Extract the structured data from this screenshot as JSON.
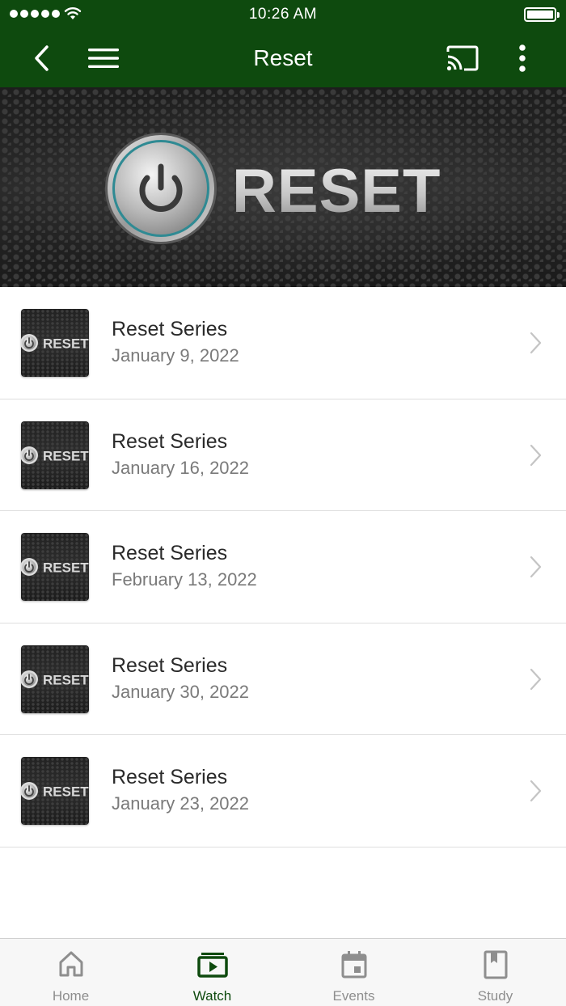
{
  "status_bar": {
    "time": "10:26 AM"
  },
  "nav": {
    "title": "Reset"
  },
  "banner": {
    "logo_text": "RESET"
  },
  "items": [
    {
      "title": "Reset Series",
      "date": "January 9, 2022",
      "thumb_text": "RESET"
    },
    {
      "title": "Reset Series",
      "date": "January 16, 2022",
      "thumb_text": "RESET"
    },
    {
      "title": "Reset Series",
      "date": "February 13, 2022",
      "thumb_text": "RESET"
    },
    {
      "title": "Reset Series",
      "date": "January 30, 2022",
      "thumb_text": "RESET"
    },
    {
      "title": "Reset Series",
      "date": "January 23, 2022",
      "thumb_text": "RESET"
    }
  ],
  "tabs": [
    {
      "label": "Home",
      "icon": "home-icon",
      "active": false
    },
    {
      "label": "Watch",
      "icon": "watch-icon",
      "active": true
    },
    {
      "label": "Events",
      "icon": "calendar-icon",
      "active": false
    },
    {
      "label": "Study",
      "icon": "book-icon",
      "active": false
    }
  ],
  "colors": {
    "brand": "#0e4a0e",
    "tab_inactive": "#8e8e8e",
    "divider": "#dedede"
  }
}
